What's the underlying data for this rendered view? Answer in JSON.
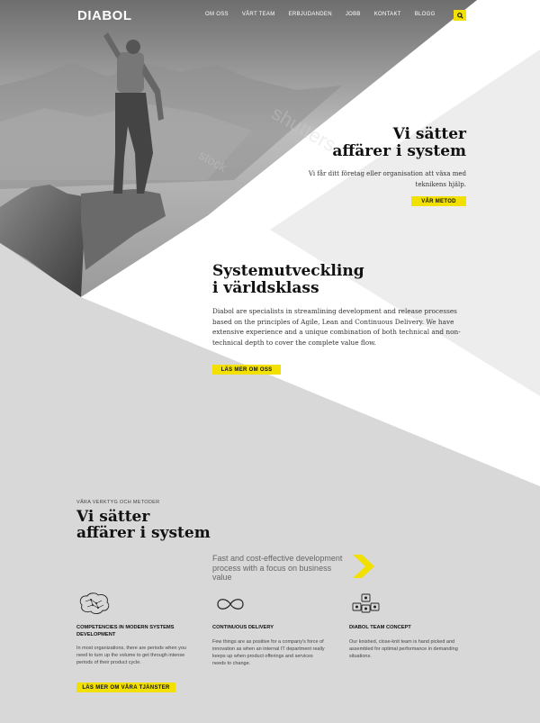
{
  "header": {
    "logo": "DIABOL",
    "nav": [
      "OM OSS",
      "VÅRT TEAM",
      "ERBJUDANDEN",
      "JOBB",
      "KONTAKT",
      "BLOGG"
    ],
    "search_icon": "search-icon"
  },
  "hero": {
    "title_line1": "Vi sätter",
    "title_line2": "affärer i system",
    "subtitle": "Vi får ditt företag eller organisation att växa med teknikens hjälp.",
    "button": "VÅR METOD"
  },
  "development": {
    "title_line1": "Systemutveckling",
    "title_line2": "i världsklass",
    "body": "Diabol are specialists in streamlining development and release processes based on the principles of Agile, Lean and Continuous Delivery. We have extensive experience and a unique combination of both technical and non-technical depth to cover the complete value flow.",
    "button": "LÄS MER OM OSS"
  },
  "tools": {
    "eyebrow": "VÅRA VERKTYG OCH METODER",
    "title_line1": "Vi sätter",
    "title_line2": "affärer i system",
    "tagline": "Fast and cost-effective development process with a focus on business value",
    "features": [
      {
        "icon": "brain-icon",
        "title": "COMPETENCIES IN MODERN SYSTEMS DEVELOPMENT",
        "text": "In most organizations, there are periods when you need to turn up the volume to get through intense periods of their product cycle."
      },
      {
        "icon": "infinity-icon",
        "title": "CONTINUOUS DELIVERY",
        "text": "Few things are as positive for a company's force of innovation as when an internal IT department really keeps up when product offerings and services needs to change."
      },
      {
        "icon": "team-icon",
        "title": "DIABOL TEAM CONCEPT",
        "text": "Our knished, close-knit team is hand picked and assembled for optimal performance in demanding situations."
      }
    ],
    "button": "LÄS MER OM VÅRA TJÄNSTER"
  },
  "colors": {
    "accent": "#f2e000",
    "gray_panel": "#d8d8d8",
    "text_dark": "#111111"
  }
}
